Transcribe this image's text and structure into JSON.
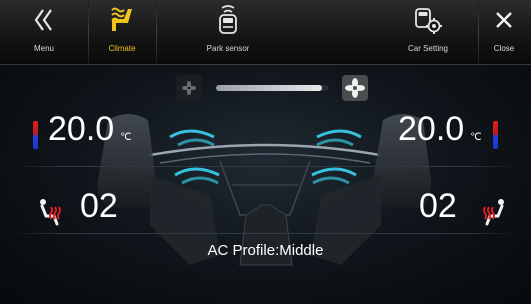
{
  "nav": {
    "menu_label": "Menu",
    "climate_label": "Climate",
    "park_sensor_label": "Park sensor",
    "car_setting_label": "Car Setting",
    "close_label": "Close",
    "active_tab": "Climate",
    "active_color": "#f0c419"
  },
  "fan": {
    "level_fraction": 0.95
  },
  "left": {
    "temperature": "20.0",
    "unit": "℃",
    "seat_level": "02"
  },
  "right": {
    "temperature": "20.0",
    "unit": "℃",
    "seat_level": "02"
  },
  "ac_profile_text": "AC Profile:Middle",
  "icons": {
    "menu": "double-chevron-left-icon",
    "climate": "climate-icon",
    "park_sensor": "park-sensor-icon",
    "car_setting": "car-setting-icon",
    "close": "close-icon",
    "fan_small": "fan-low-icon",
    "fan_large": "fan-high-icon",
    "seat_heater": "seat-heater-icon"
  },
  "colors": {
    "heat": "#e02020",
    "cool": "#2040e0",
    "airflow": "#3ad4f0"
  }
}
